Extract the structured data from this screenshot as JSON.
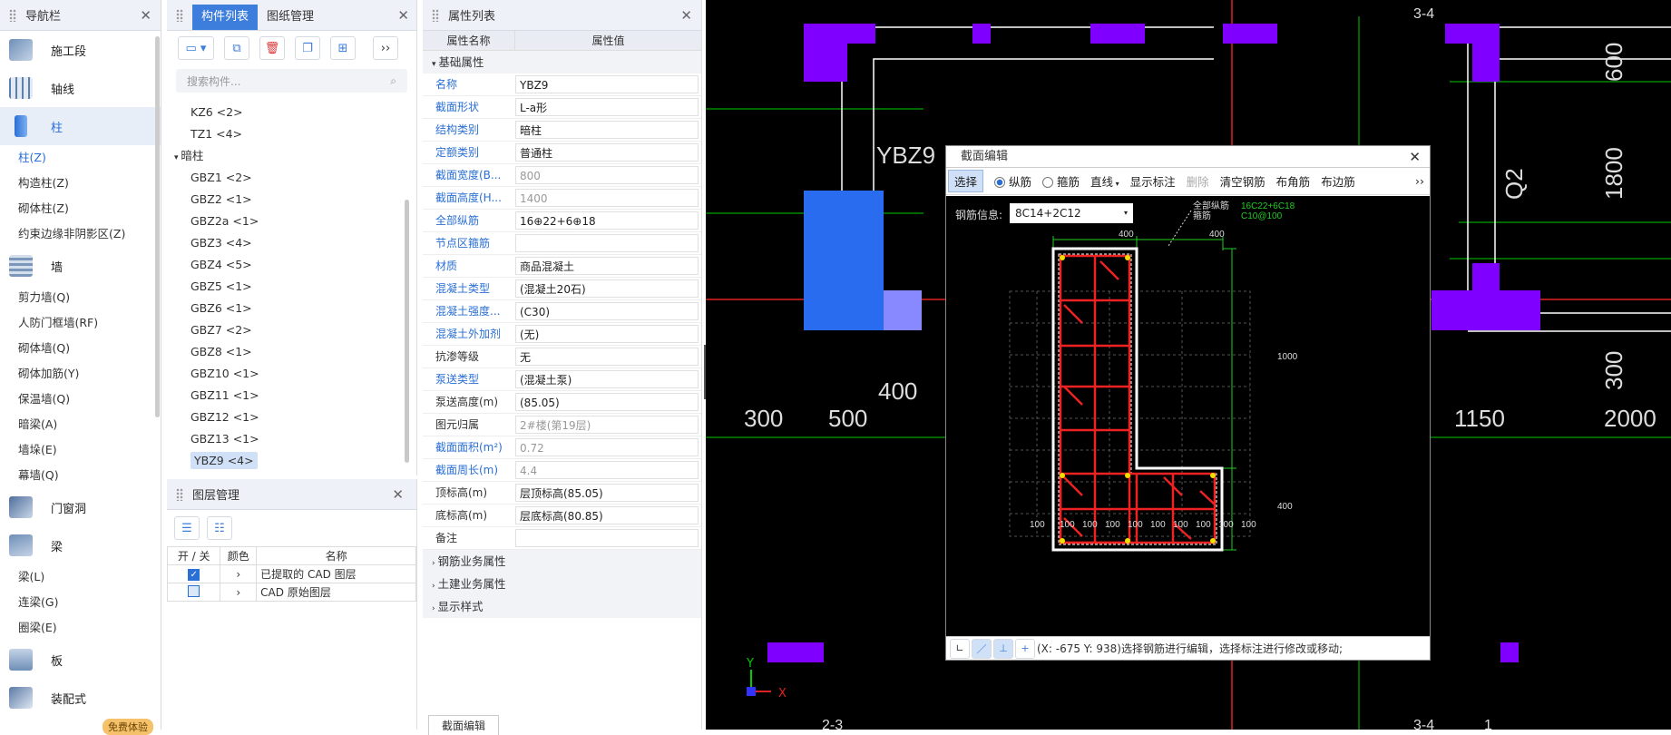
{
  "nav": {
    "title": "导航栏",
    "categories": [
      {
        "label": "施工段"
      },
      {
        "label": "轴线"
      },
      {
        "label": "柱",
        "subs": [
          "柱(Z)",
          "构造柱(Z)",
          "砌体柱(Z)",
          "约束边缘非阴影区(Z)"
        ]
      },
      {
        "label": "墙",
        "subs": [
          "剪力墙(Q)",
          "人防门框墙(RF)",
          "砌体墙(Q)",
          "砌体加筋(Y)",
          "保温墙(Q)",
          "暗梁(A)",
          "墙垛(E)",
          "幕墙(Q)"
        ]
      },
      {
        "label": "门窗洞"
      },
      {
        "label": "梁",
        "subs": [
          "梁(L)",
          "连梁(G)",
          "圈梁(E)"
        ]
      },
      {
        "label": "板"
      },
      {
        "label": "装配式"
      }
    ],
    "trial_badge": "免费体验"
  },
  "components": {
    "tab_list": "构件列表",
    "tab_drawings": "图纸管理",
    "search_placeholder": "搜索构件...",
    "items_top": [
      "KZ6 <2>",
      "TZ1 <4>"
    ],
    "group_label": "暗柱",
    "items": [
      "GBZ1 <2>",
      "GBZ2 <1>",
      "GBZ2a <1>",
      "GBZ3 <4>",
      "GBZ4 <5>",
      "GBZ5 <1>",
      "GBZ6 <1>",
      "GBZ7 <2>",
      "GBZ8 <1>",
      "GBZ10 <1>",
      "GBZ11 <1>",
      "GBZ12 <1>",
      "GBZ13 <1>",
      "YBZ9 <4>"
    ]
  },
  "layers": {
    "title": "图层管理",
    "headers": [
      "开 / 关",
      "颜色",
      "名称"
    ],
    "rows": [
      {
        "name": "已提取的 CAD 图层",
        "checked": true
      },
      {
        "name": "CAD 原始图层",
        "checked": false
      }
    ]
  },
  "props": {
    "title": "属性列表",
    "col_name": "属性名称",
    "col_value": "属性值",
    "section_basic": "基础属性",
    "rows": [
      {
        "k": "名称",
        "v": "YBZ9",
        "blue": true,
        "gray": false
      },
      {
        "k": "截面形状",
        "v": "L-a形",
        "blue": true,
        "gray": false
      },
      {
        "k": "结构类别",
        "v": "暗柱",
        "blue": true,
        "gray": false
      },
      {
        "k": "定额类别",
        "v": "普通柱",
        "blue": true,
        "gray": false
      },
      {
        "k": "截面宽度(B...",
        "v": "800",
        "blue": true,
        "gray": true
      },
      {
        "k": "截面高度(H...",
        "v": "1400",
        "blue": true,
        "gray": true
      },
      {
        "k": "全部纵筋",
        "v": "16⊕22+6⊕18",
        "blue": true,
        "gray": false
      },
      {
        "k": "节点区箍筋",
        "v": "",
        "blue": true,
        "gray": false
      },
      {
        "k": "材质",
        "v": "商品混凝土",
        "blue": true,
        "gray": false
      },
      {
        "k": "混凝土类型",
        "v": "(混凝土20石)",
        "blue": true,
        "gray": false
      },
      {
        "k": "混凝土强度...",
        "v": "(C30)",
        "blue": true,
        "gray": false
      },
      {
        "k": "混凝土外加剂",
        "v": "(无)",
        "blue": true,
        "gray": false
      },
      {
        "k": "抗渗等级",
        "v": "无",
        "blue": false,
        "gray": false
      },
      {
        "k": "泵送类型",
        "v": "(混凝土泵)",
        "blue": true,
        "gray": false
      },
      {
        "k": "泵送高度(m)",
        "v": "(85.05)",
        "blue": false,
        "gray": false
      },
      {
        "k": "图元归属",
        "v": "2#楼(第19层)",
        "blue": false,
        "gray": true
      },
      {
        "k": "截面面积(m²)",
        "v": "0.72",
        "blue": true,
        "gray": true
      },
      {
        "k": "截面周长(m)",
        "v": "4.4",
        "blue": true,
        "gray": true
      },
      {
        "k": "顶标高(m)",
        "v": "层顶标高(85.05)",
        "blue": false,
        "gray": false
      },
      {
        "k": "底标高(m)",
        "v": "层底标高(80.85)",
        "blue": false,
        "gray": false
      },
      {
        "k": "备注",
        "v": "",
        "blue": false,
        "gray": false
      }
    ],
    "sections": [
      "钢筋业务属性",
      "土建业务属性",
      "显示样式"
    ],
    "bottom_tab": "截面编辑"
  },
  "cad": {
    "labels": [
      "YBZ9",
      "400",
      "300",
      "500",
      "1150",
      "2000",
      "600",
      "1800",
      "Q2",
      "300",
      "3-4",
      "3-4",
      "2-3",
      "1"
    ],
    "axis_x": "X",
    "axis_y": "Y"
  },
  "dialog": {
    "title": "截面编辑",
    "tools": [
      "选择",
      "纵筋",
      "箍筋",
      "直线",
      "显示标注",
      "删除",
      "清空钢筋",
      "布角筋",
      "布边筋"
    ],
    "rebar_label": "钢筋信息:",
    "rebar_value": "8C14+2C12",
    "note1": "全部纵筋",
    "note2": "箍筋",
    "note1_val": "16C22+6C18",
    "note2_val": "C10@100",
    "dims": [
      "400",
      "400",
      "1000",
      "400"
    ],
    "grid_labels": [
      "100",
      "100",
      "100",
      "100",
      "100",
      "100",
      "100",
      "100",
      "100",
      "100"
    ],
    "status": "(X: -675 Y: 938)选择钢筋进行编辑，选择标注进行修改或移动;"
  }
}
